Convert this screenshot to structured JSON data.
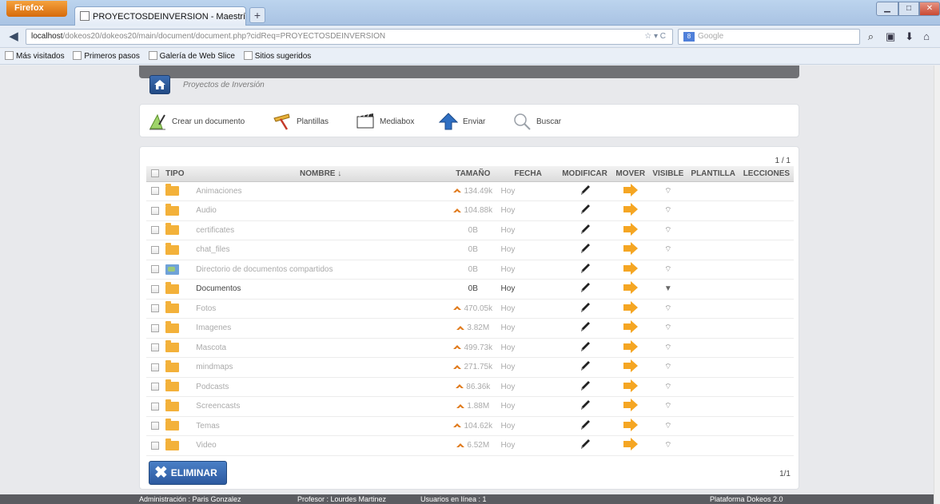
{
  "browser": {
    "menu_label": "Firefox",
    "tab_title": "PROYECTOSDEINVERSION - Maestría en ...",
    "new_tab": "+",
    "url_host": "localhost",
    "url_rest": "/dokeos20/dokeos20/main/document/document.php?cidReq=PROYECTOSDEINVERSION",
    "search_placeholder": "Google",
    "bookmarks": [
      "Más visitados",
      "Primeros pasos",
      "Galería de Web Slice",
      "Sitios sugeridos"
    ]
  },
  "breadcrumb": "Proyectos de Inversión",
  "toolbar": {
    "create": "Crear un documento",
    "templates": "Plantillas",
    "mediabox": "Mediabox",
    "send": "Enviar",
    "search": "Buscar"
  },
  "pager": {
    "top": "1 / 1",
    "bottom": "1/1"
  },
  "table": {
    "headers": {
      "tipo": "TIPO",
      "nombre": "NOMBRE ↓",
      "tamano": "TAMAÑO",
      "fecha": "FECHA",
      "modificar": "MODIFICAR",
      "mover": "MOVER",
      "visible": "VISIBLE",
      "plantilla": "PLANTILLA",
      "lecciones": "LECCIONES"
    },
    "rows": [
      {
        "name": "Animaciones",
        "size": "134.49k",
        "date": "Hoy",
        "active": false,
        "updated": true,
        "shared": false
      },
      {
        "name": "Audio",
        "size": "104.88k",
        "date": "Hoy",
        "active": false,
        "updated": true,
        "shared": false
      },
      {
        "name": "certificates",
        "size": "0B",
        "date": "Hoy",
        "active": false,
        "updated": false,
        "shared": false
      },
      {
        "name": "chat_files",
        "size": "0B",
        "date": "Hoy",
        "active": false,
        "updated": false,
        "shared": false
      },
      {
        "name": "Directorio de documentos compartidos",
        "size": "0B",
        "date": "Hoy",
        "active": false,
        "updated": false,
        "shared": true
      },
      {
        "name": "Documentos",
        "size": "0B",
        "date": "Hoy",
        "active": true,
        "updated": false,
        "shared": false
      },
      {
        "name": "Fotos",
        "size": "470.05k",
        "date": "Hoy",
        "active": false,
        "updated": true,
        "shared": false
      },
      {
        "name": "Imagenes",
        "size": "3.82M",
        "date": "Hoy",
        "active": false,
        "updated": true,
        "shared": false
      },
      {
        "name": "Mascota",
        "size": "499.73k",
        "date": "Hoy",
        "active": false,
        "updated": true,
        "shared": false
      },
      {
        "name": "mindmaps",
        "size": "271.75k",
        "date": "Hoy",
        "active": false,
        "updated": true,
        "shared": false
      },
      {
        "name": "Podcasts",
        "size": "86.36k",
        "date": "Hoy",
        "active": false,
        "updated": true,
        "shared": false
      },
      {
        "name": "Screencasts",
        "size": "1.88M",
        "date": "Hoy",
        "active": false,
        "updated": true,
        "shared": false
      },
      {
        "name": "Temas",
        "size": "104.62k",
        "date": "Hoy",
        "active": false,
        "updated": true,
        "shared": false
      },
      {
        "name": "Video",
        "size": "6.52M",
        "date": "Hoy",
        "active": false,
        "updated": true,
        "shared": false
      }
    ]
  },
  "delete_label": "ELIMINAR",
  "footer": {
    "admin": "Administración : Paris Gonzalez",
    "teacher": "Profesor : Lourdes Martinez",
    "online": "Usuarios en línea : 1",
    "platform": "Plataforma Dokeos 2.0"
  }
}
